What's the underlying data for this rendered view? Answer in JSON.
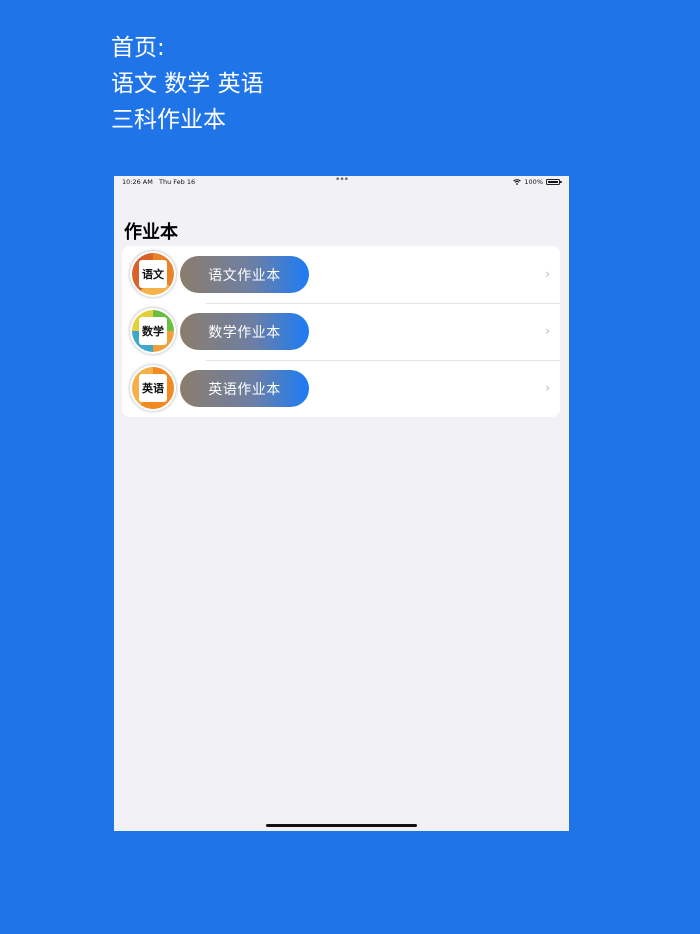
{
  "caption": {
    "line1": "首页:",
    "line2": "语文 数学 英语",
    "line3": "三科作业本"
  },
  "status_bar": {
    "time": "10:26 AM",
    "date": "Thu Feb 16",
    "battery": "100%"
  },
  "nav": {
    "title": "作业本"
  },
  "rows": [
    {
      "label": "语文作业本",
      "icon_text": "语文",
      "ring_color": "#e8832c"
    },
    {
      "label": "数学作业本",
      "icon_text": "数学",
      "ring_color": "#6bbf3f"
    },
    {
      "label": "英语作业本",
      "icon_text": "英语",
      "ring_color": "#ef8a24"
    }
  ],
  "colors": {
    "background": "#1f74e8",
    "screen": "#f2f1f6",
    "pill_start": "#8b7d6c",
    "pill_end": "#1c7cf5"
  }
}
